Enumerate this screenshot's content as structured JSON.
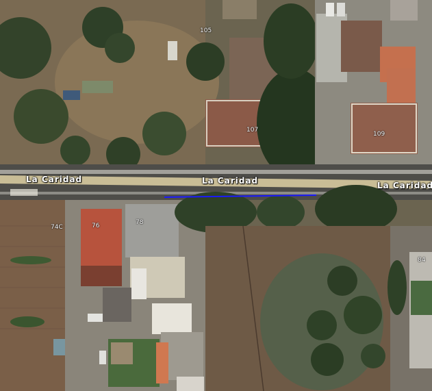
{
  "map": {
    "road_labels": [
      "La Caridad",
      "La Caridad",
      "La Caridad"
    ],
    "house_numbers": [
      "105",
      "107",
      "109",
      "74C",
      "76",
      "78",
      "84"
    ],
    "colors": {
      "road_fill": "#c9bd96",
      "road_asphalt": "#4e4d49",
      "highlight_line": "#1a1aff",
      "roof_red": "#b7533d",
      "roof_grey": "#9e9e9a",
      "vegetation": "#2f3f25",
      "soil": "#7a6247"
    }
  }
}
